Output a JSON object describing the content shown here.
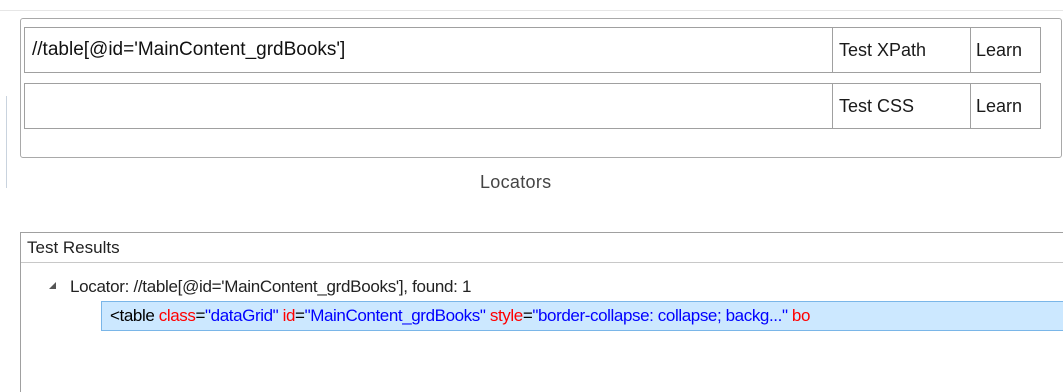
{
  "locators": {
    "caption": "Locators",
    "xpath": {
      "value": "//table[@id='MainContent_grdBooks']",
      "test_label": "Test XPath",
      "learn_label": "Learn"
    },
    "css": {
      "value": "",
      "test_label": "Test CSS",
      "learn_label": "Learn"
    }
  },
  "results": {
    "header": "Test Results",
    "node": {
      "label": "Locator: //table[@id='MainContent_grdBooks'], found: 1",
      "child": {
        "open": "<table",
        "attrs": [
          {
            "name": "class",
            "value": "\"dataGrid\""
          },
          {
            "name": "id",
            "value": "\"MainContent_grdBooks\""
          },
          {
            "name": "style",
            "value": "\"border-collapse: collapse; backg...\""
          }
        ],
        "trailing": "bo"
      }
    }
  }
}
